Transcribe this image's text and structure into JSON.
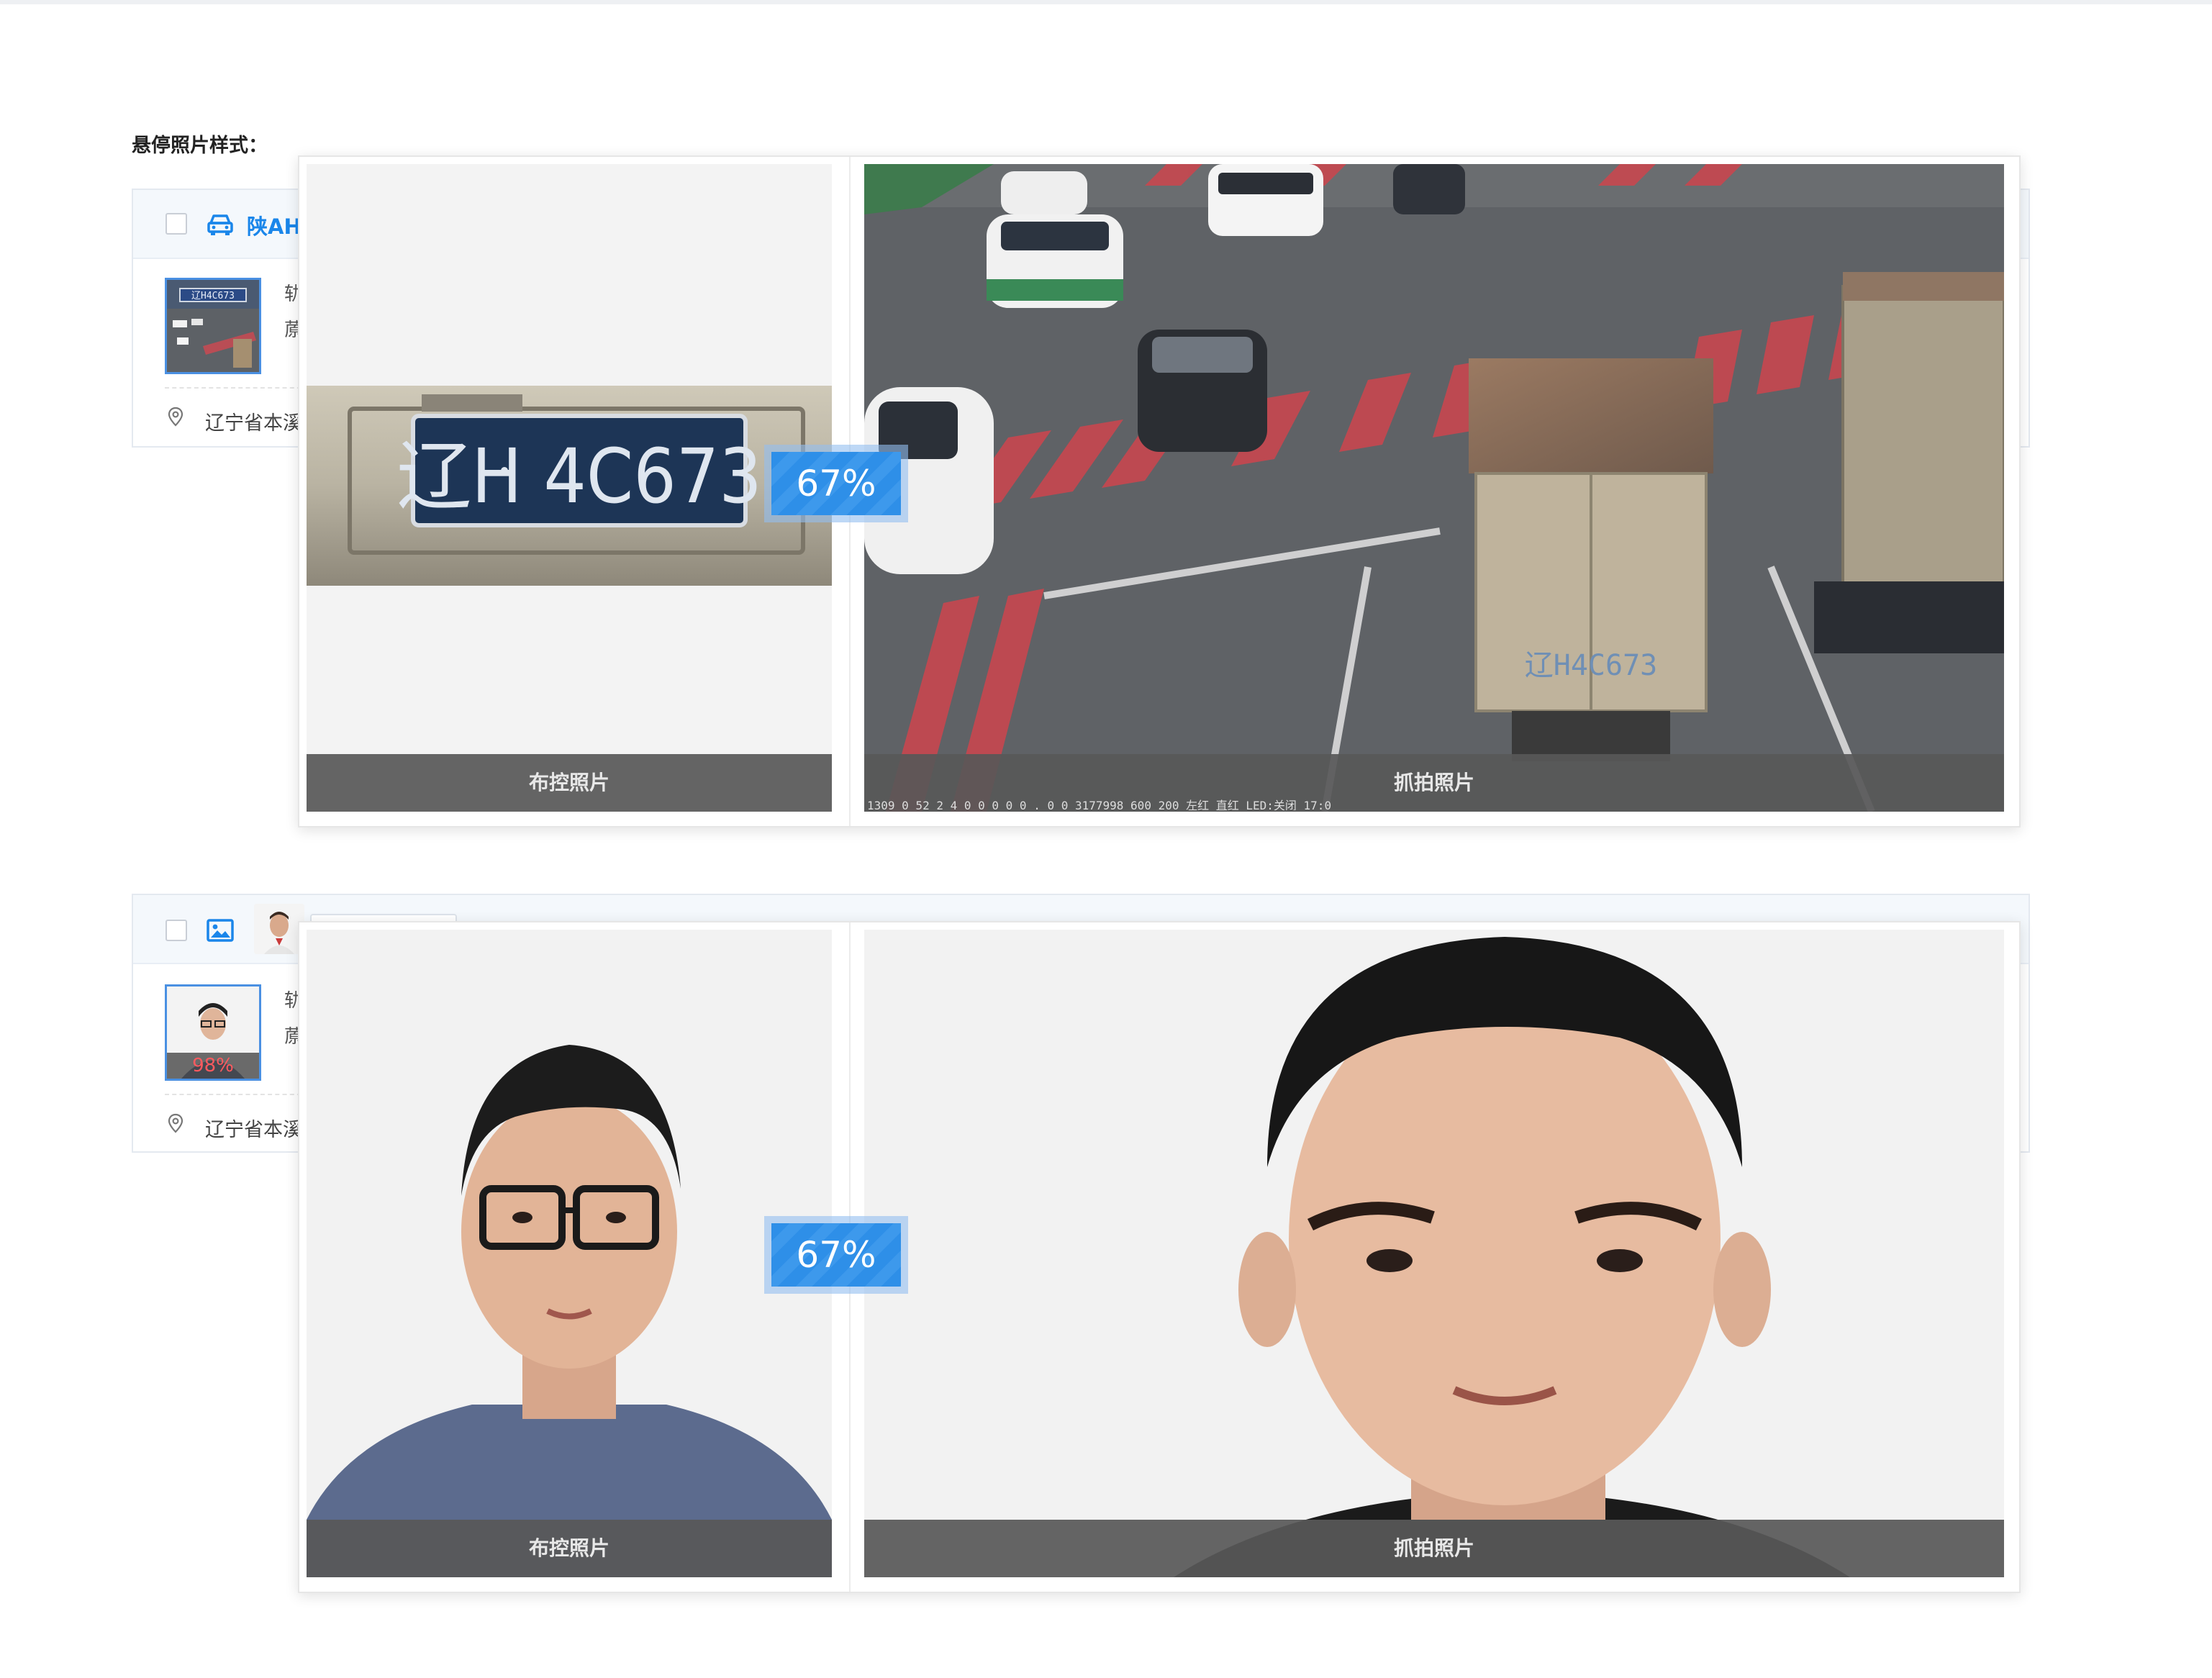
{
  "section_title": "悬停照片样式：",
  "cards": [
    {
      "head_type": "vehicle",
      "plate": "陕AH",
      "meta_line_1": "轨",
      "meta_line_2": "蒝",
      "location": "辽宁省本溪"
    },
    {
      "head_type": "face",
      "thumb_score": "98%",
      "meta_line_1": "轨",
      "meta_line_2": "蒝",
      "location": "辽宁省本溪"
    }
  ],
  "popovers": [
    {
      "kind": "vehicle",
      "left_caption": "布控照片",
      "right_caption": "抓拍照片",
      "score": "67%",
      "plate_text": "辽H 4C673",
      "truck_plate": "辽H4C673",
      "cam_overlay": "1309 0 52 2 4  0 0 0 0 0 . 0 0 3177998  600 200  左红 直红  LED:关闭  17:0"
    },
    {
      "kind": "face",
      "left_caption": "布控照片",
      "right_caption": "抓拍照片",
      "score": "67%"
    }
  ],
  "colors": {
    "accent": "#1a86ea",
    "score_red": "#ff5a5f",
    "caption_bg": "#585858"
  },
  "icons": [
    "car-icon",
    "image-icon",
    "location-pin-icon"
  ]
}
